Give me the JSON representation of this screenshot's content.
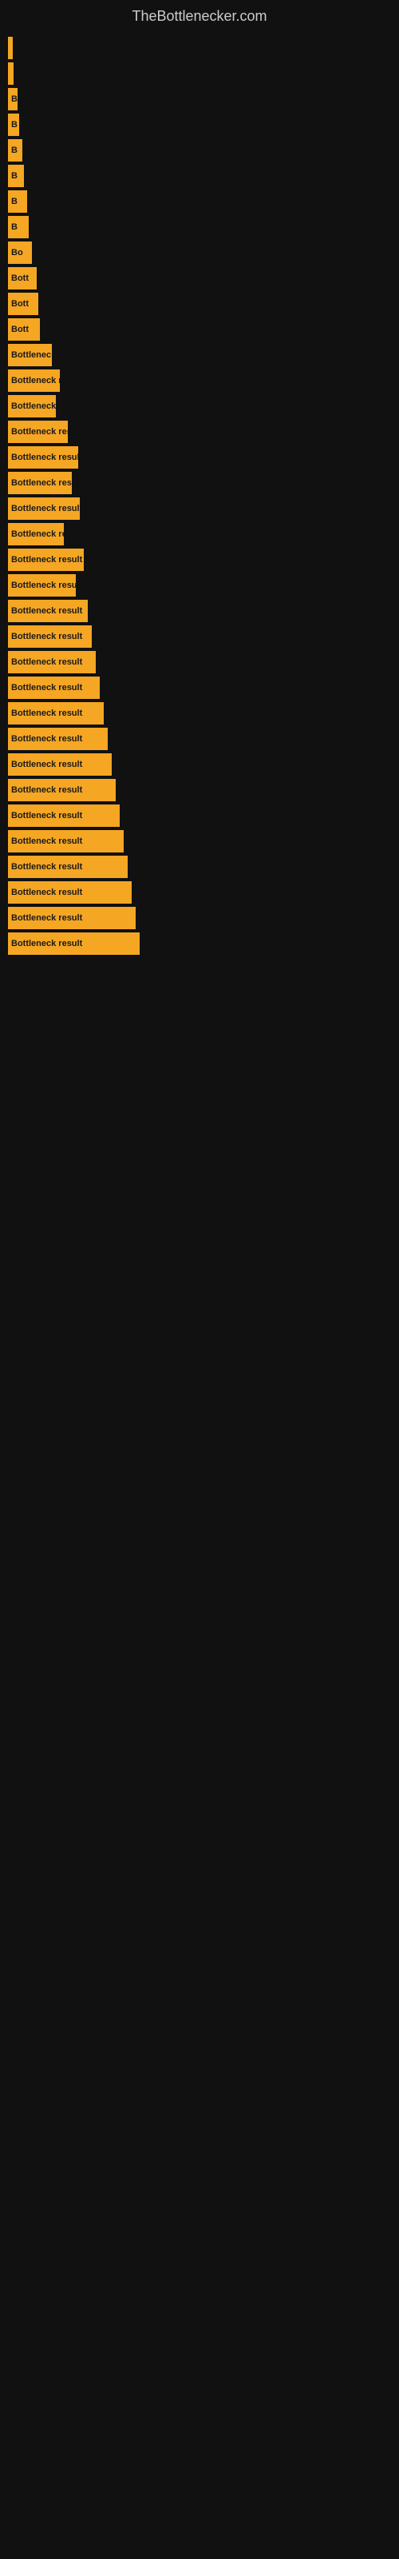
{
  "site": {
    "title": "TheBottlenecker.com"
  },
  "bars": [
    {
      "id": 1,
      "width": 6,
      "label": ""
    },
    {
      "id": 2,
      "width": 7,
      "label": ""
    },
    {
      "id": 3,
      "width": 12,
      "label": "B"
    },
    {
      "id": 4,
      "width": 14,
      "label": "B"
    },
    {
      "id": 5,
      "width": 18,
      "label": "B"
    },
    {
      "id": 6,
      "width": 20,
      "label": "B"
    },
    {
      "id": 7,
      "width": 24,
      "label": "B"
    },
    {
      "id": 8,
      "width": 26,
      "label": "B"
    },
    {
      "id": 9,
      "width": 30,
      "label": "Bo"
    },
    {
      "id": 10,
      "width": 36,
      "label": "Bott"
    },
    {
      "id": 11,
      "width": 38,
      "label": "Bott"
    },
    {
      "id": 12,
      "width": 40,
      "label": "Bott"
    },
    {
      "id": 13,
      "width": 55,
      "label": "Bottlenec"
    },
    {
      "id": 14,
      "width": 65,
      "label": "Bottleneck re"
    },
    {
      "id": 15,
      "width": 60,
      "label": "Bottleneck"
    },
    {
      "id": 16,
      "width": 75,
      "label": "Bottleneck resu"
    },
    {
      "id": 17,
      "width": 88,
      "label": "Bottleneck result"
    },
    {
      "id": 18,
      "width": 80,
      "label": "Bottleneck resu"
    },
    {
      "id": 19,
      "width": 90,
      "label": "Bottleneck result"
    },
    {
      "id": 20,
      "width": 70,
      "label": "Bottleneck re"
    },
    {
      "id": 21,
      "width": 95,
      "label": "Bottleneck result"
    },
    {
      "id": 22,
      "width": 85,
      "label": "Bottleneck resu"
    },
    {
      "id": 23,
      "width": 100,
      "label": "Bottleneck result"
    },
    {
      "id": 24,
      "width": 105,
      "label": "Bottleneck result"
    },
    {
      "id": 25,
      "width": 110,
      "label": "Bottleneck result"
    },
    {
      "id": 26,
      "width": 115,
      "label": "Bottleneck result"
    },
    {
      "id": 27,
      "width": 120,
      "label": "Bottleneck result"
    },
    {
      "id": 28,
      "width": 125,
      "label": "Bottleneck result"
    },
    {
      "id": 29,
      "width": 130,
      "label": "Bottleneck result"
    },
    {
      "id": 30,
      "width": 135,
      "label": "Bottleneck result"
    },
    {
      "id": 31,
      "width": 140,
      "label": "Bottleneck result"
    },
    {
      "id": 32,
      "width": 145,
      "label": "Bottleneck result"
    },
    {
      "id": 33,
      "width": 150,
      "label": "Bottleneck result"
    },
    {
      "id": 34,
      "width": 155,
      "label": "Bottleneck result"
    },
    {
      "id": 35,
      "width": 160,
      "label": "Bottleneck result"
    },
    {
      "id": 36,
      "width": 165,
      "label": "Bottleneck result"
    }
  ],
  "colors": {
    "background": "#111111",
    "bar": "#f5a623",
    "title": "#cccccc",
    "barText": "#1a1a1a"
  }
}
